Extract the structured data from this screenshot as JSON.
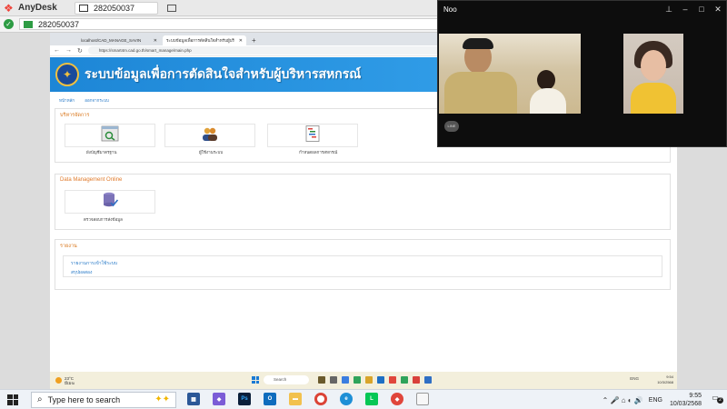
{
  "anydesk": {
    "app_name": "AnyDesk",
    "tab_id": "282050037",
    "address": "282050037"
  },
  "browser": {
    "tabs": [
      {
        "label": "localhost/CAD_MANAGE_SAVIN"
      },
      {
        "label": "ระบบข้อมูลเพื่อการตัดสินใจสำหรับผู้บริ"
      }
    ],
    "url": "https://smart4m.cad.go.th/smart_manage/main.php"
  },
  "site": {
    "title": "ระบบข้อมูลเพื่อการตัดสินใจสำหรับผู้บริหารสหกรณ์",
    "breadcrumb": [
      "หน้าหลัก",
      "ออกจากระบบ"
    ]
  },
  "panels": {
    "admin": {
      "title": "บริหารจัดการ",
      "tiles": [
        {
          "label": "ผังบัญชีมาตรฐาน",
          "icon": "chart-of-accounts-icon"
        },
        {
          "label": "ผู้ใช้งานระบบ",
          "icon": "users-icon"
        },
        {
          "label": "กำหนดผลการสหกรณ์",
          "icon": "gantt-icon"
        }
      ]
    },
    "data_management": {
      "title": "Data Management Online",
      "tiles": [
        {
          "label": "ตรวจสอบการส่งข้อมูล",
          "icon": "database-check-icon"
        }
      ]
    },
    "reports": {
      "title": "รายงาน",
      "links": [
        "รายงานการเข้าใช้ระบบ",
        "สรุปผลสอง"
      ]
    }
  },
  "remote_taskbar": {
    "weather_temp": "23°C",
    "weather_text": "มีเมฆ",
    "search_placeholder": "Search",
    "lang": "ENG",
    "time": "9:54",
    "date": "10/3/2568"
  },
  "video_call": {
    "title": "Noo",
    "logo": "LINE"
  },
  "taskbar": {
    "search_placeholder": "Type here to search",
    "lang": "ENG",
    "time": "9:55",
    "date": "10/03/2568",
    "notification_count": "2"
  },
  "colors": {
    "header_blue": "#2f9be6",
    "accent_orange": "#d9761b",
    "link_blue": "#2a7bc8",
    "anydesk_red": "#ef443b"
  }
}
